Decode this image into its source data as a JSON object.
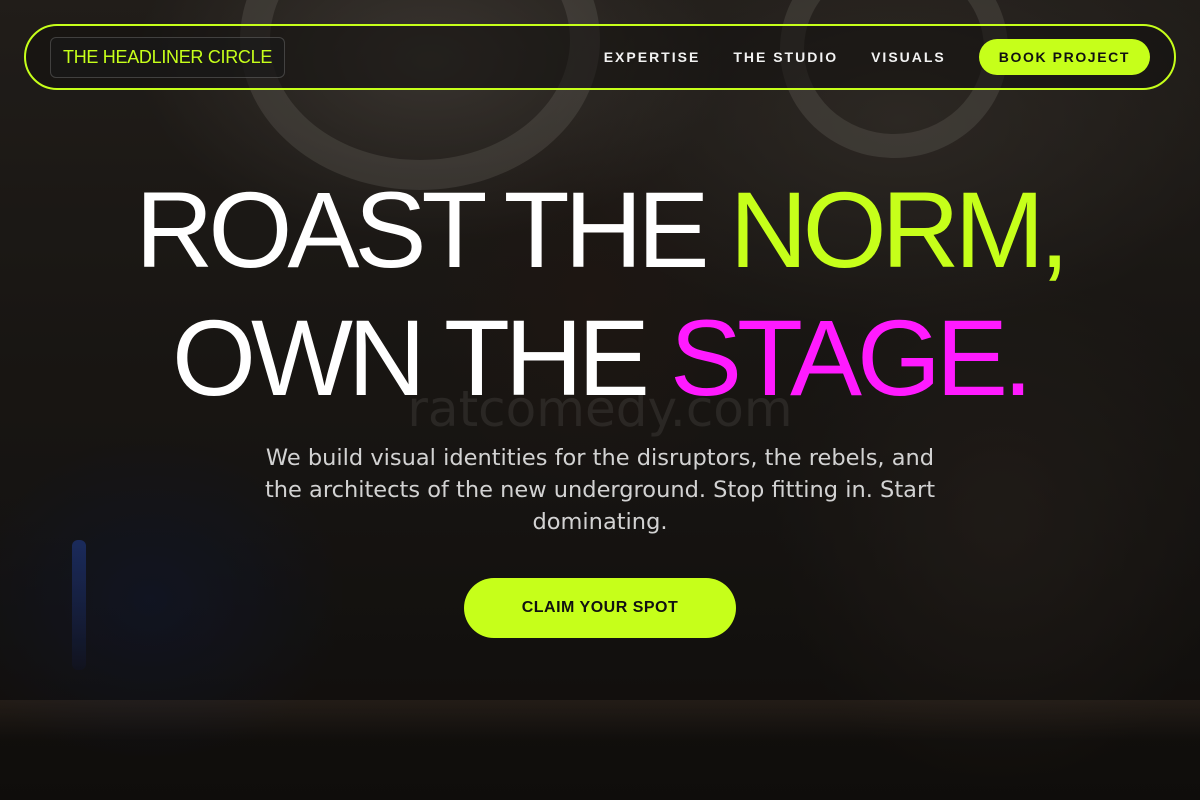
{
  "colors": {
    "accent_lime": "#c6ff1a",
    "accent_pink": "#ff1aff",
    "text": "#ffffff"
  },
  "nav": {
    "logo": "THE HEADLINER CIRCLE",
    "links": [
      "EXPERTISE",
      "THE STUDIO",
      "VISUALS"
    ],
    "cta": "BOOK PROJECT"
  },
  "hero": {
    "line1_white": "ROAST THE",
    "line1_accent": "NORM,",
    "line2_white": "OWN THE",
    "line2_accent": "STAGE.",
    "subtitle": "We build visual identities for the disruptors, the rebels, and the architects of the new underground. Stop fitting in. Start dominating.",
    "cta": "CLAIM YOUR SPOT"
  },
  "watermark": "ratcomedy.com"
}
